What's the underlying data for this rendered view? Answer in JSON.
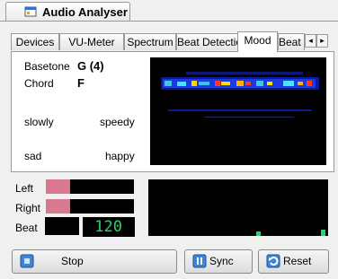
{
  "window": {
    "title": "Audio Analyser",
    "icon": "app-window-icon"
  },
  "tabs": [
    {
      "label": "Devices",
      "active": false
    },
    {
      "label": "VU-Meter",
      "active": false
    },
    {
      "label": "Spectrum",
      "active": false
    },
    {
      "label": "Beat Detection",
      "active": false
    },
    {
      "label": "Mood",
      "active": true
    },
    {
      "label": "Beat C",
      "active": false
    }
  ],
  "mood": {
    "basetone_label": "Basetone",
    "basetone_value": "G (4)",
    "chord_label": "Chord",
    "chord_value": "F",
    "slowly": "slowly",
    "speedy": "speedy",
    "sad": "sad",
    "happy": "happy"
  },
  "levels": {
    "left_label": "Left",
    "right_label": "Right",
    "beat_label": "Beat",
    "left_level": 0.28,
    "right_level": 0.28,
    "bpm": "120",
    "fill_color": "#d9788f",
    "bpm_color": "#29d36b"
  },
  "buttons": {
    "stop": {
      "label": "Stop",
      "icon": "stop-icon"
    },
    "sync": {
      "label": "Sync",
      "icon": "sync-icon"
    },
    "reset": {
      "label": "Reset",
      "icon": "reset-icon"
    }
  }
}
